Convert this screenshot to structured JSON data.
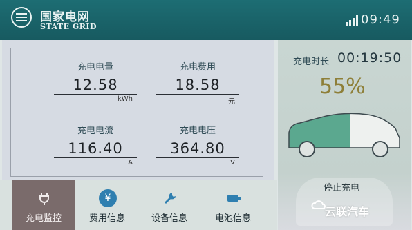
{
  "header": {
    "brand_cn": "国家电网",
    "brand_en": "STATE GRID",
    "time": "09:49"
  },
  "metrics": [
    {
      "label": "充电电量",
      "value": "12.58",
      "unit": "kWh"
    },
    {
      "label": "充电费用",
      "value": "18.58",
      "unit": "元"
    },
    {
      "label": "充电电流",
      "value": "116.40",
      "unit": "A"
    },
    {
      "label": "充电电压",
      "value": "364.80",
      "unit": "V"
    }
  ],
  "charging": {
    "time_label": "充电时长",
    "time_value": "00:19:50",
    "percent_label": "55%",
    "percent": 55,
    "stop_label": "停止充电"
  },
  "nav": [
    {
      "label": "充电监控",
      "icon": "plug-icon"
    },
    {
      "label": "费用信息",
      "icon": "yen-icon"
    },
    {
      "label": "设备信息",
      "icon": "wrench-icon"
    },
    {
      "label": "电池信息",
      "icon": "battery-icon"
    }
  ],
  "watermark": "云联汽车",
  "colors": {
    "header": "#1d6d73",
    "percent": "#8e7f38",
    "active_tab": "#7a6b6b",
    "icon_blue": "#2f7fb0"
  }
}
